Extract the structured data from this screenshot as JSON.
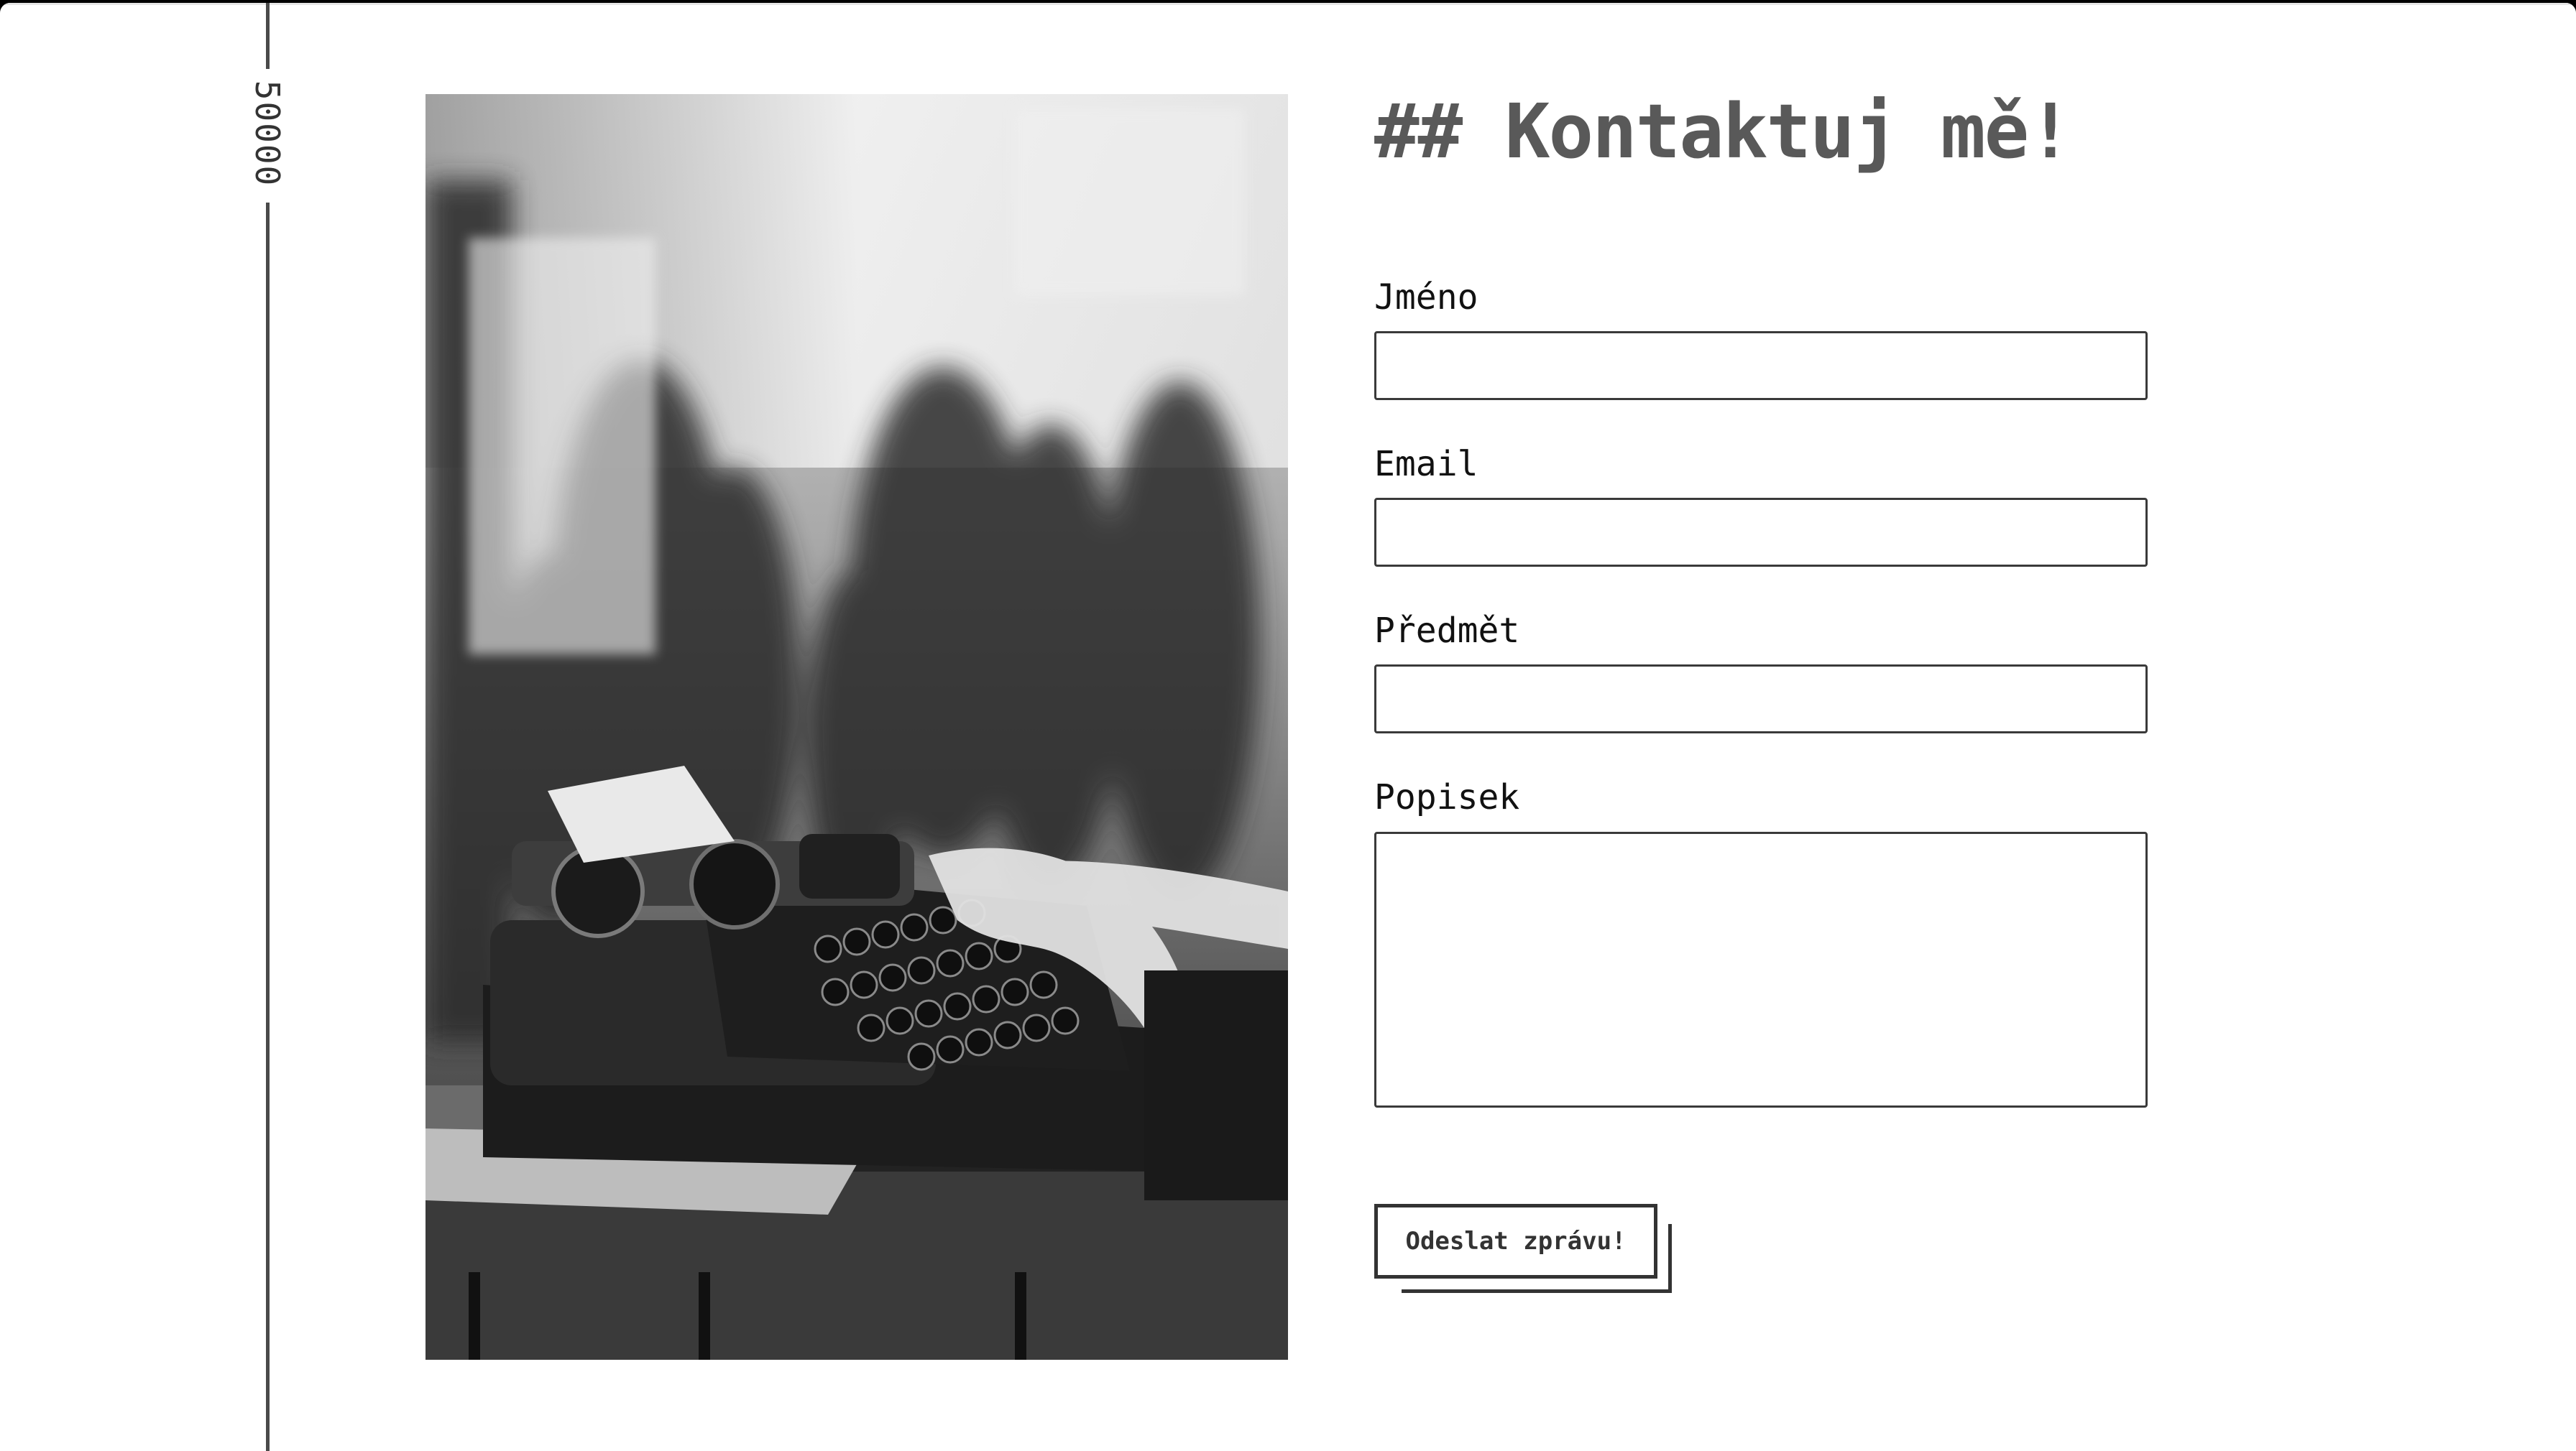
{
  "side_rail": {
    "label": "50000"
  },
  "contact": {
    "heading": "## Kontaktuj mě!",
    "fields": [
      {
        "label": "Jméno",
        "value": "",
        "placeholder": ""
      },
      {
        "label": "Email",
        "value": "",
        "placeholder": ""
      },
      {
        "label": "Předmět",
        "value": "",
        "placeholder": ""
      },
      {
        "label": "Popisek",
        "value": "",
        "placeholder": ""
      }
    ],
    "submit_label": "Odeslat zprávu!"
  },
  "colors": {
    "heading": "#595959",
    "border": "#3a3a3a",
    "rail": "#4a4a4a",
    "background": "#ffffff"
  },
  "icons": {
    "photo": "typewriter-photo"
  }
}
